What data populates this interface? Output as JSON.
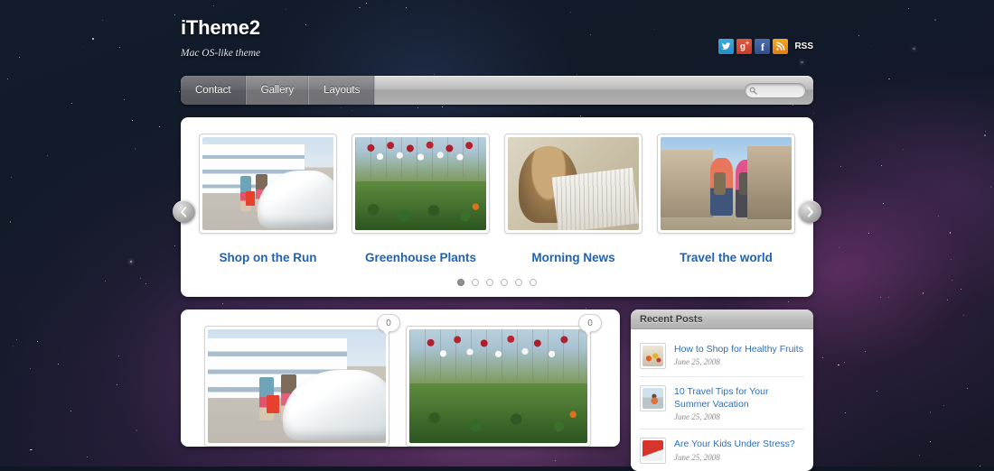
{
  "site": {
    "title": "iTheme2",
    "tagline": "Mac OS-like theme"
  },
  "social": {
    "items": [
      {
        "name": "twitter",
        "glyph": "t"
      },
      {
        "name": "google-plus",
        "glyph": "g+"
      },
      {
        "name": "facebook",
        "glyph": "f"
      },
      {
        "name": "rss",
        "glyph": "rss"
      }
    ],
    "rss_label": "RSS"
  },
  "nav": {
    "items": [
      {
        "label": "Contact",
        "active": true
      },
      {
        "label": "Gallery",
        "active": false
      },
      {
        "label": "Layouts",
        "active": false
      }
    ]
  },
  "search": {
    "value": "",
    "placeholder": "",
    "icon": "search-icon"
  },
  "slider": {
    "prev_icon": "chevron-left-icon",
    "next_icon": "chevron-right-icon",
    "slides": [
      {
        "caption": "Shop on the Run",
        "image": "shopping-street-white-car"
      },
      {
        "caption": "Greenhouse Plants",
        "image": "greenhouse-hanging-red-flowers"
      },
      {
        "caption": "Morning News",
        "image": "woman-reading-newspaper"
      },
      {
        "caption": "Travel the world",
        "image": "two-travellers-with-backpacks"
      }
    ],
    "dots": [
      {
        "active": true
      },
      {
        "active": false
      },
      {
        "active": false
      },
      {
        "active": false
      },
      {
        "active": false
      },
      {
        "active": false
      }
    ]
  },
  "content": {
    "posts": [
      {
        "image": "shopping-street-white-car",
        "comment_count": "0"
      },
      {
        "image": "greenhouse-hanging-red-flowers",
        "comment_count": "0"
      }
    ]
  },
  "sidebar": {
    "widget_title": "Recent Posts",
    "posts": [
      {
        "title": "How to Shop for Healthy Fruits",
        "date": "June 25, 2008",
        "thumb": "fruit-basket"
      },
      {
        "title": "10 Travel Tips for Your Summer Vacation",
        "date": "June 25, 2008",
        "thumb": "woman-on-vacation"
      },
      {
        "title": "Are Your Kids Under Stress?",
        "date": "June 25, 2008",
        "thumb": "red-book-object"
      }
    ]
  },
  "colors": {
    "link_blue": "#1f63b4",
    "sidebar_link": "#2f6fbd",
    "background_dark": "#111a27",
    "nebula_magenta": "#b94ba5"
  }
}
